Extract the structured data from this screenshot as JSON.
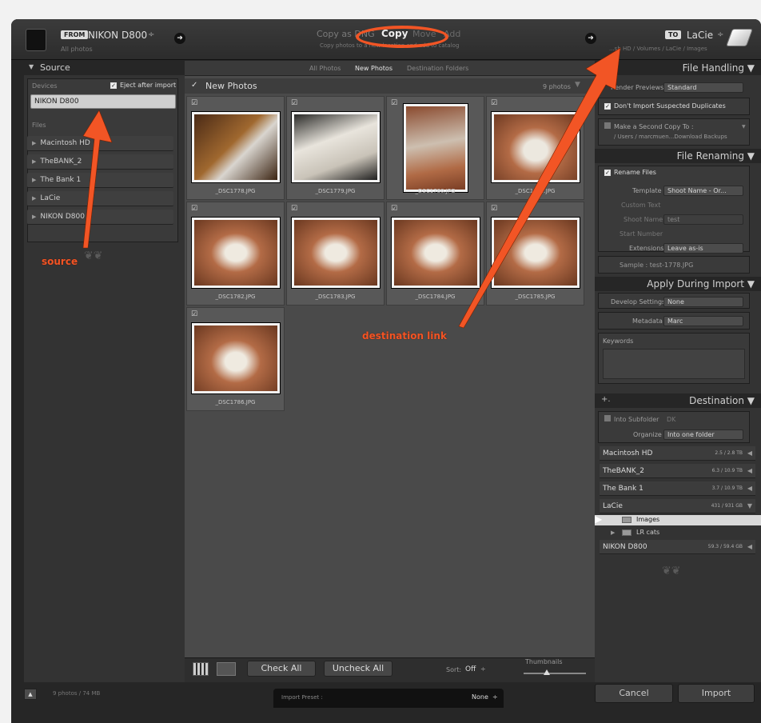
{
  "topbar": {
    "from_badge": "FROM",
    "from_source": "NIKON D800",
    "from_updown": "÷",
    "from_sub": "All photos",
    "modes": [
      "Copy as DNG",
      "Copy",
      "Move",
      "Add"
    ],
    "mode_desc": "Copy photos to a new location and add to catalog",
    "to_badge": "TO",
    "to_dest": "LaCie",
    "to_updown": "÷",
    "to_sub": "...sh HD / Volumes / LaCie / Images"
  },
  "source_panel": {
    "header": "Source",
    "devices_label": "Devices",
    "eject_label": "Eject after import",
    "device": "NIKON D800",
    "files_label": "Files",
    "volumes": [
      "Macintosh HD",
      "TheBANK_2",
      "The Bank 1",
      "LaCie",
      "NIKON D800"
    ]
  },
  "center": {
    "tabs": [
      "All Photos",
      "New Photos",
      "Destination Folders"
    ],
    "group_title": "New Photos",
    "count": "9 photos",
    "thumbnails": [
      "_DSC1778.JPG",
      "_DSC1779.JPG",
      "_DSC1780.JPG",
      "_DSC1781.JPG",
      "_DSC1782.JPG",
      "_DSC1783.JPG",
      "_DSC1784.JPG",
      "_DSC1785.JPG",
      "_DSC1786.JPG"
    ],
    "check_all": "Check All",
    "uncheck_all": "Uncheck All",
    "sort_label": "Sort:",
    "sort_value": "Off",
    "thumbnails_label": "Thumbnails"
  },
  "file_handling": {
    "header": "File Handling",
    "render_label": "Render Previews",
    "render_value": "Standard",
    "dup_label": "Don't Import Suspected Duplicates",
    "second_copy_label": "Make a Second Copy To :",
    "second_copy_path": "/ Users / marcmuen...Download Backups"
  },
  "file_renaming": {
    "header": "File Renaming",
    "rename_label": "Rename Files",
    "template_label": "Template",
    "template_value": "Shoot Name - Or...",
    "custom_text_label": "Custom Text",
    "shoot_name_label": "Shoot Name",
    "shoot_name_value": "test",
    "start_number_label": "Start Number",
    "extensions_label": "Extensions",
    "extensions_value": "Leave as-is",
    "sample": "Sample : test-1778.JPG"
  },
  "apply_import": {
    "header": "Apply During Import",
    "develop_label": "Develop Settings",
    "develop_value": "None",
    "metadata_label": "Metadata",
    "metadata_value": "Marc",
    "keywords_label": "Keywords"
  },
  "destination": {
    "header": "Destination",
    "plus": "+.",
    "subfolder_label": "Into Subfolder",
    "subfolder_value": "DK",
    "organize_label": "Organize",
    "organize_value": "Into one folder",
    "volumes": [
      {
        "name": "Macintosh HD",
        "size": "2.5 / 2.8 TB"
      },
      {
        "name": "TheBANK_2",
        "size": "6.3 / 10.9 TB"
      },
      {
        "name": "The Bank 1",
        "size": "3.7 / 10.9 TB"
      },
      {
        "name": "LaCie",
        "size": "431 / 931 GB"
      },
      {
        "name": "NIKON D800",
        "size": "59.3 / 59.4 GB"
      }
    ],
    "folders": [
      "Images",
      "LR cats"
    ]
  },
  "bottom": {
    "status": "9 photos / 74 MB",
    "preset_label": "Import Preset :",
    "preset_value": "None",
    "cancel": "Cancel",
    "import": "Import"
  },
  "annotations": {
    "source": "source",
    "destination": "destination link"
  },
  "colors": {
    "annotation": "#f25525",
    "window": "#262626",
    "panel": "#333333",
    "grid": "#4a4a4a"
  }
}
